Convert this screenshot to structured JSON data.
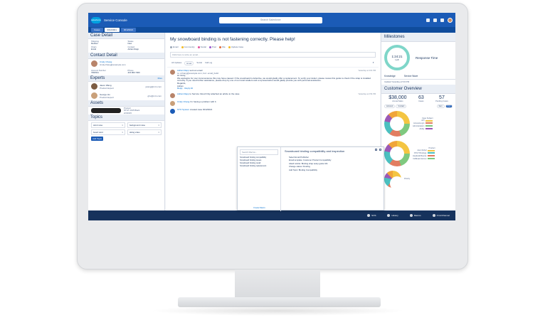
{
  "app": {
    "logo": "salesforce",
    "title": "Service Console",
    "search_placeholder": "Search Salesforce"
  },
  "tabs": [
    {
      "label": "Cases"
    },
    {
      "label": "00123021"
    },
    {
      "label": "00123021"
    }
  ],
  "case_detail": {
    "heading": "Case Detail",
    "fields": [
      {
        "label": "Shipping",
        "value": "Medium"
      },
      {
        "label": "Status",
        "value": "New"
      },
      {
        "label": "Origin",
        "value": "Email"
      },
      {
        "label": "Contact",
        "value": "Adrian Rapp"
      }
    ]
  },
  "contact_detail": {
    "heading": "Contact Detail",
    "name": "Cindy Chang",
    "email": "cindy.chang@example.com",
    "fields": [
      {
        "label": "Account Number",
        "value": "7981541"
      },
      {
        "label": "Phone",
        "value": "415.800.7000"
      }
    ]
  },
  "experts": {
    "heading": "Experts",
    "more": "More",
    "people": [
      {
        "name": "Jason Wang",
        "role": "Product Expert",
        "email": "jwang@mtn.com"
      },
      {
        "name": "George Hu",
        "role": "Product Expert",
        "email": "ghu@mtn.com"
      }
    ]
  },
  "assets": {
    "heading": "Assets",
    "product_label": "Product",
    "product_value": "NTGT 2015 Black",
    "date": "2/2/2015"
  },
  "topics": {
    "heading": "Topics",
    "items": [
      "wind noise",
      "background noise",
      "board wind",
      "skiing video"
    ],
    "add_label": "Add Topic"
  },
  "feed": {
    "subject": "My snowboard binding is not fastening correctly. Please help!",
    "publisher_tabs": [
      "Email",
      "Community",
      "Social",
      "Post",
      "File",
      "Update Case"
    ],
    "composer_placeholder": "Click here to write an email...",
    "filters": [
      "All Updates",
      "Email",
      "Social",
      "Call Log"
    ],
    "items": [
      {
        "author": "Adrian Rapp",
        "action": "sent an email",
        "time": "Yesterday at 4:01 PM",
        "to": "to: cchang@example.com, bcc: email_build",
        "greeting": "Hi Cindy,",
        "body": "We apologize for your inconvenience this may have caused. If the snowboard is defective, we would gladly offer a replacement. To verify your defect, please review this guide to check if the strap is installed correctly. If you need further assistance, please drop by one of our local retailers and a representative would gladly provide you with personal assistance.",
        "signoff": "Regards,",
        "name": "Adrian",
        "reply": "Reply",
        "reply_all": "Reply All"
      },
      {
        "author": "Adrian Rapp",
        "action": "to Service Cloud Only attached an article to the case",
        "time": "Yesterday at 2:54 PM"
      },
      {
        "author": "Cindy Chang",
        "action": "I'm having a problem with b",
        "time": ""
      },
      {
        "author": "NTO System",
        "action": "created case 00123021",
        "time": ""
      }
    ]
  },
  "macro": {
    "search_placeholder": "Search Macros...",
    "items": [
      "Snowboard binding compatibility",
      "Snowboard binding issues",
      "Snowboard binding recall",
      "Snowboard binding replacement"
    ],
    "create_label": "Create Macro",
    "title": "Snowboard binding compatibility and inspection",
    "steps": [
      "Select Email Publisher",
      "Email template: Customer Product Compatibility",
      "Attach article: Binding strap setup guide 101",
      "Change status: Pending",
      "Add Topic: Binding Compatibility"
    ]
  },
  "milestones": {
    "heading": "Milestones",
    "timer": "1:24:21",
    "timer_label": "Left",
    "metric": "Response Time"
  },
  "knowledge": {
    "tabs": [
      "Knowledge",
      "Service Wave"
    ],
    "note": "Updated Yesterday at 5:03 PM"
  },
  "customer_overview": {
    "heading": "Customer Overview",
    "metrics": [
      {
        "value": "$38,000",
        "label": "Annual Sales"
      },
      {
        "value": "63",
        "label": "Cases"
      },
      {
        "value": "57",
        "label": "Pending Cases"
      }
    ],
    "segments": [
      "Account",
      "Contact",
      "Item",
      "Pull"
    ],
    "chart1_title": "Case Subject",
    "chart1_legend": [
      "API",
      "Access/Login",
      "Administration",
      "Ability"
    ],
    "chart2_title": "Product",
    "chart2_legend": [
      "Aero Rebel",
      "NTGT Bindings",
      "Headwall Beanie",
      "NoBreak Helmet"
    ],
    "chart3_title": "Priority"
  },
  "footer": [
    "SOS",
    "History",
    "Macros",
    "OmniChannel"
  ]
}
